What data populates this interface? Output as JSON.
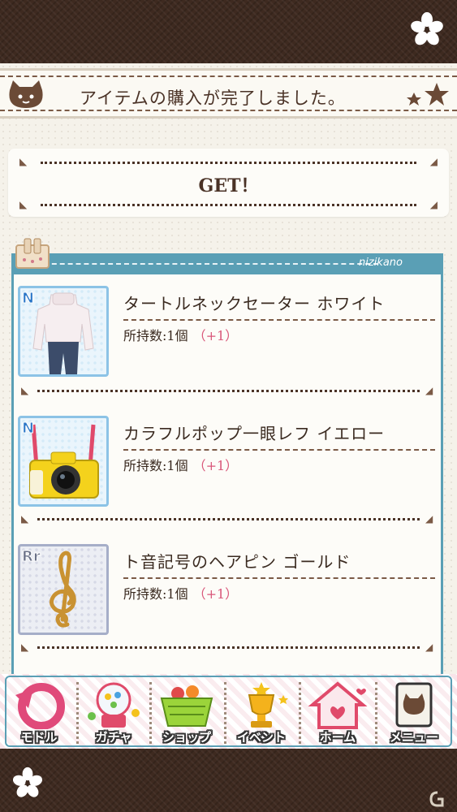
{
  "header": {
    "title": "アイテムの購入が完了しました。"
  },
  "result": {
    "get_label": "GET！"
  },
  "panel": {
    "brand": "nizikano"
  },
  "items": [
    {
      "rarity": "N",
      "name": "タートルネックセーター ホワイト",
      "qty_label": "所持数:1個",
      "qty_increment": "（+1）",
      "icon": "sweater-icon"
    },
    {
      "rarity": "N",
      "name": "カラフルポップ一眼レフ イエロー",
      "qty_label": "所持数:1個",
      "qty_increment": "（+1）",
      "icon": "camera-icon"
    },
    {
      "rarity": "Rr",
      "name": "ト音記号のヘアピン ゴールド",
      "qty_label": "所持数:1個",
      "qty_increment": "（+1）",
      "icon": "treble-clef-icon"
    }
  ],
  "nav": {
    "back": "モドル",
    "gacha": "ガチャ",
    "shop": "ショップ",
    "event": "イベント",
    "home": "ホーム",
    "menu": "メニュー"
  },
  "colors": {
    "brown_dark": "#3e2a20",
    "accent_blue": "#5a9fb5",
    "increment_pink": "#d9577a"
  }
}
